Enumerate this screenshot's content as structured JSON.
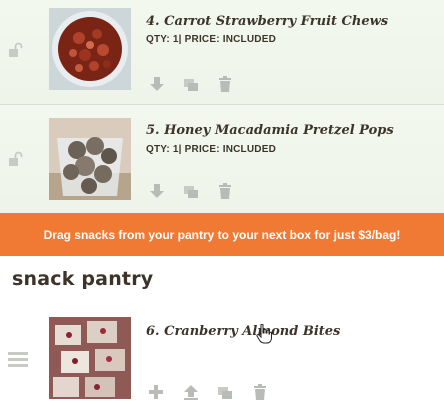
{
  "queue_items": [
    {
      "title": "4. Carrot Strawberry Fruit Chews",
      "meta": "QTY: 1| PRICE: INCLUDED"
    },
    {
      "title": "5. Honey Macadamia Pretzel Pops",
      "meta": "QTY: 1| PRICE: INCLUDED"
    }
  ],
  "banner": {
    "text": "Drag snacks from your pantry to your next box for just $3/bag!"
  },
  "pantry": {
    "title": "snack pantry",
    "items": [
      {
        "title": "6. Cranberry Almond Bites"
      }
    ]
  },
  "colors": {
    "accent": "#f07a34",
    "row_background": "#f3f8ef",
    "text": "#3d3429",
    "icon": "#b9bcb6"
  },
  "icons": {
    "queue_row": [
      "lock-icon",
      "move-down-icon",
      "duplicate-icon",
      "trash-icon"
    ],
    "pantry_row": [
      "drag-handle-icon",
      "add-icon",
      "move-up-icon",
      "duplicate-icon",
      "trash-icon"
    ]
  }
}
